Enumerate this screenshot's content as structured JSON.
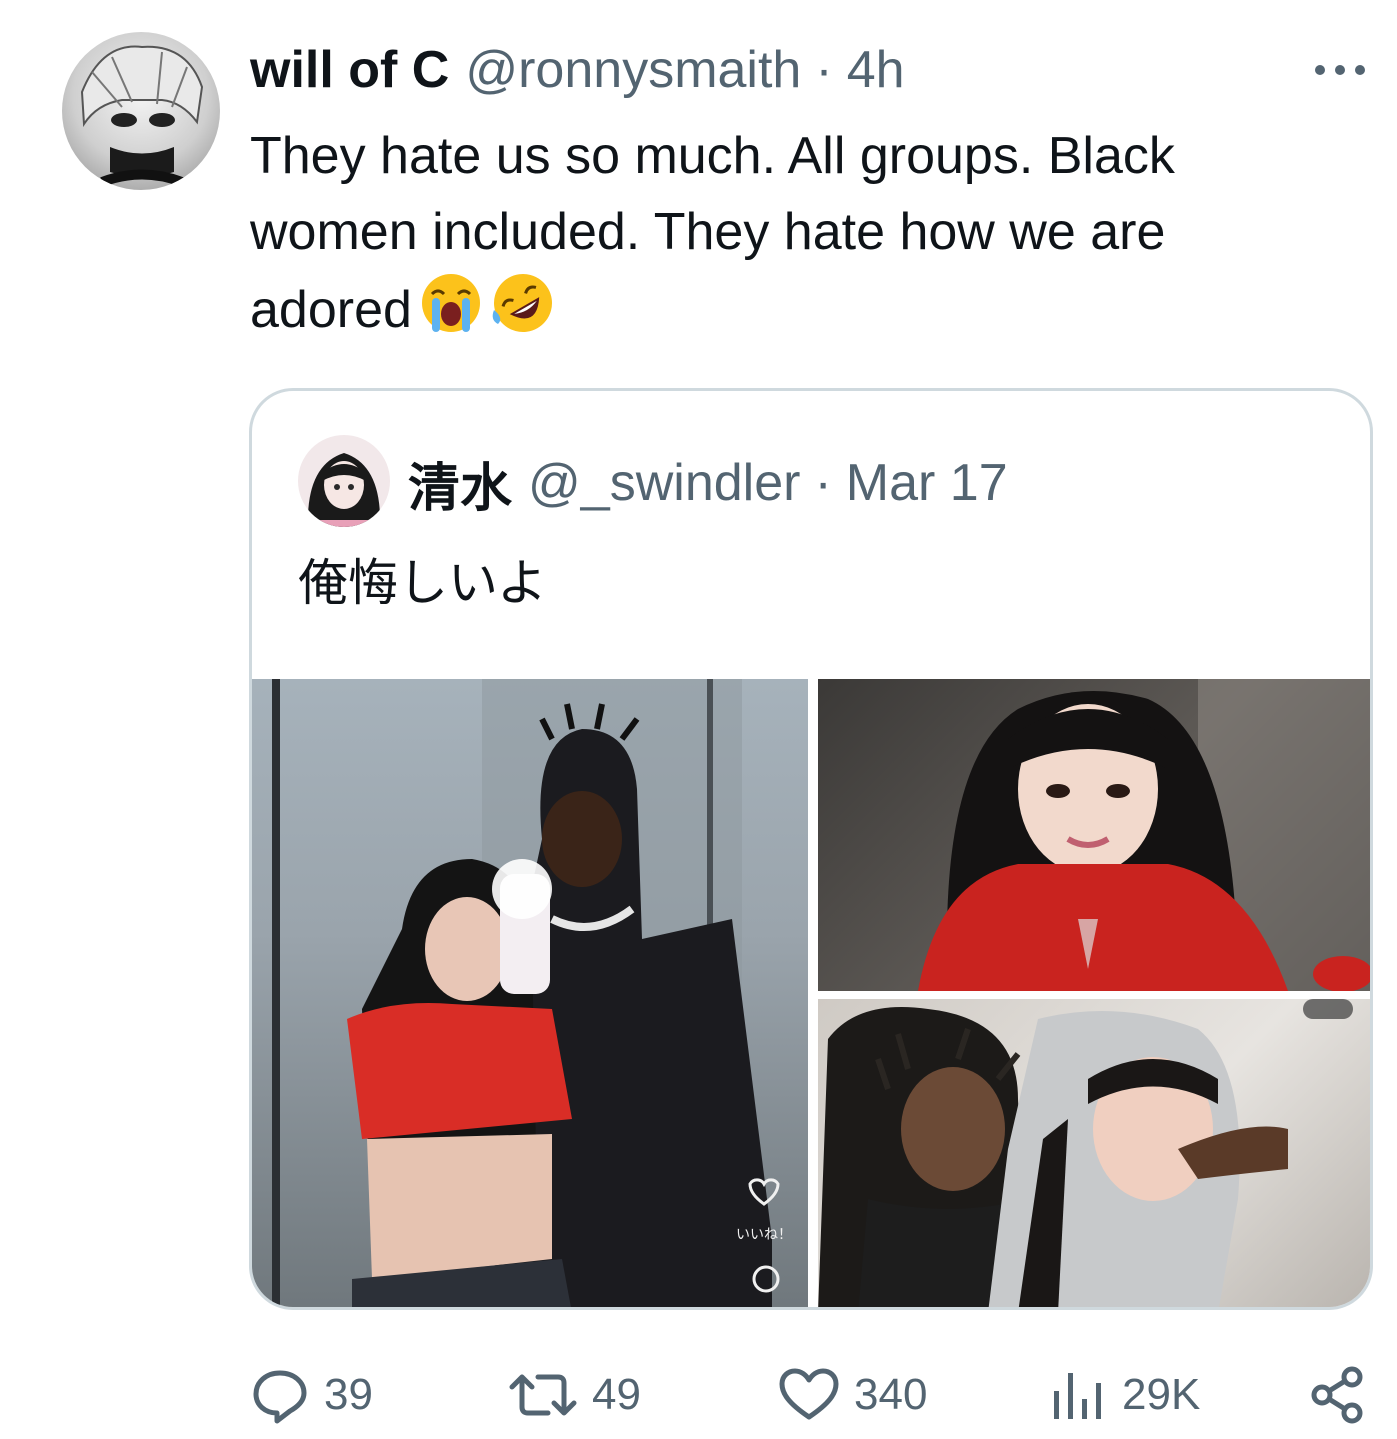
{
  "tweet": {
    "display_name": "will of C",
    "handle": "@ronnysmaith",
    "separator": "·",
    "time": "4h",
    "text": "They hate us so much. All groups. Black women included. They hate how we are adored",
    "emojis": [
      "loudly-crying-face",
      "rolling-on-floor-laughing"
    ],
    "more_icon": "more-horizontal-icon"
  },
  "quote": {
    "display_name": "清水",
    "handle": "@_swindler",
    "separator": "·",
    "time": "Mar 17",
    "text": "俺悔しいよ",
    "photos": [
      {
        "name": "mirror-selfie-photo",
        "overlay_text": "いいね！"
      },
      {
        "name": "woman-portrait-photo"
      },
      {
        "name": "couple-hoodie-photo"
      }
    ]
  },
  "actions": {
    "replies": "39",
    "retweets": "49",
    "likes": "340",
    "views": "29K"
  },
  "colors": {
    "text_primary": "#0f1419",
    "text_secondary": "#536471",
    "border": "#cfd9de"
  }
}
